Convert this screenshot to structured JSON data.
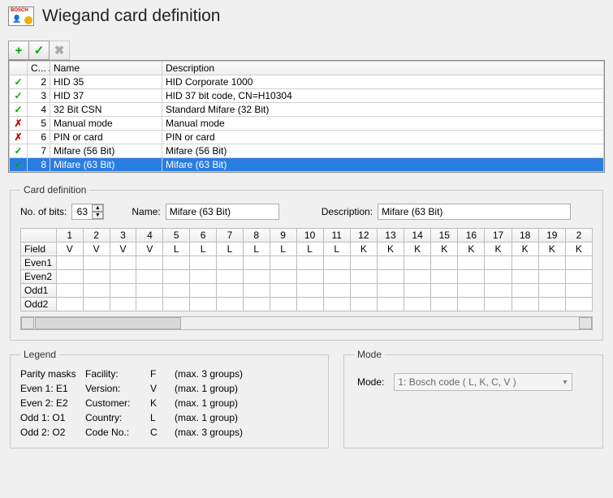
{
  "page_title": "Wiegand card definition",
  "toolbar": {
    "add_tip": "Add",
    "apply_tip": "Apply",
    "delete_tip": "Delete"
  },
  "list": {
    "col_c": "C...",
    "col_name": "Name",
    "col_desc": "Description",
    "rows": [
      {
        "status": "ok",
        "count": "2",
        "name": "HID 35",
        "desc": "HID Corporate 1000"
      },
      {
        "status": "ok",
        "count": "3",
        "name": "HID 37",
        "desc": "HID 37 bit code, CN=H10304"
      },
      {
        "status": "ok",
        "count": "4",
        "name": "32 Bit CSN",
        "desc": "Standard Mifare (32 Bit)"
      },
      {
        "status": "bad",
        "count": "5",
        "name": "Manual mode",
        "desc": "Manual mode"
      },
      {
        "status": "bad",
        "count": "6",
        "name": "PIN or card",
        "desc": "PIN or card"
      },
      {
        "status": "ok",
        "count": "7",
        "name": "Mifare (56 Bit)",
        "desc": "Mifare (56 Bit)"
      },
      {
        "status": "ok",
        "count": "8",
        "name": "Mifare (63 Bit)",
        "desc": "Mifare (63 Bit)",
        "selected": true
      }
    ]
  },
  "card_def": {
    "legend": "Card definition",
    "no_of_bits_label": "No. of bits:",
    "no_of_bits_value": "63",
    "name_label": "Name:",
    "name_value": "Mifare (63 Bit)",
    "desc_label": "Description:",
    "desc_value": "Mifare (63 Bit)",
    "grid": {
      "row_headers": [
        "Field",
        "Even1",
        "Even2",
        "Odd1",
        "Odd2"
      ],
      "col_headers": [
        "1",
        "2",
        "3",
        "4",
        "5",
        "6",
        "7",
        "8",
        "9",
        "10",
        "11",
        "12",
        "13",
        "14",
        "15",
        "16",
        "17",
        "18",
        "19",
        "2"
      ],
      "field_row": [
        "V",
        "V",
        "V",
        "V",
        "L",
        "L",
        "L",
        "L",
        "L",
        "L",
        "L",
        "K",
        "K",
        "K",
        "K",
        "K",
        "K",
        "K",
        "K",
        "K"
      ]
    }
  },
  "legend_box": {
    "legend": "Legend",
    "pm_label": "Parity masks",
    "even1": "Even 1: E1",
    "even2": "Even 2: E2",
    "odd1": "Odd 1:  O1",
    "odd2": "Odd 2:  O2",
    "facility_l": "Facility:",
    "facility_c": "F",
    "facility_n": "(max. 3 groups)",
    "version_l": "Version:",
    "version_c": "V",
    "version_n": "(max. 1 group)",
    "customer_l": "Customer:",
    "customer_c": "K",
    "customer_n": "(max. 1 group)",
    "country_l": "Country:",
    "country_c": "L",
    "country_n": "(max. 1 group)",
    "codeno_l": "Code No.:",
    "codeno_c": "C",
    "codeno_n": "(max. 3 groups)"
  },
  "mode_box": {
    "legend": "Mode",
    "label": "Mode:",
    "value": "1: Bosch code          ( L, K, C, V )"
  }
}
